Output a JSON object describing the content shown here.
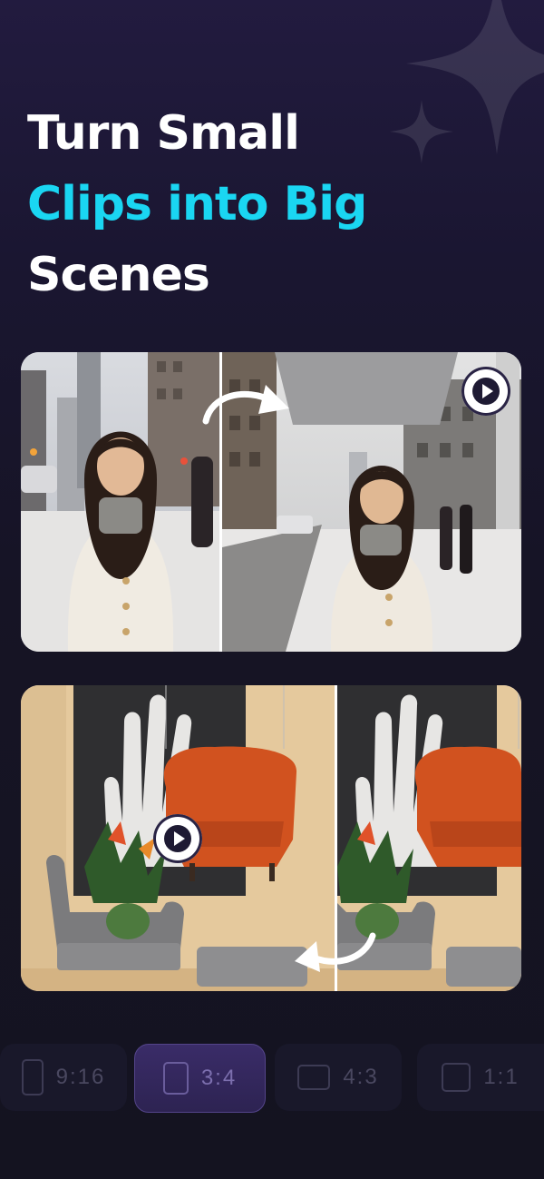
{
  "headline": {
    "line1": "Turn Small",
    "line2": "Clips into Big",
    "line3": "Scenes"
  },
  "colors": {
    "accent": "#1ad6f2",
    "background": "#161425",
    "selected_ratio": "#2d2352"
  },
  "cards": [
    {
      "name": "street-portrait-comparison",
      "before": "original-clip",
      "after": "expanded-clip",
      "play_icon": "play-icon",
      "arrow_icon": "curved-arrow-right-icon"
    },
    {
      "name": "interior-chairs-comparison",
      "before": "expanded-clip",
      "after": "original-clip",
      "play_icon": "play-icon",
      "arrow_icon": "curved-arrow-left-icon"
    }
  ],
  "ratios": [
    {
      "label": "9:16",
      "selected": false
    },
    {
      "label": "3:4",
      "selected": true
    },
    {
      "label": "4:3",
      "selected": false
    },
    {
      "label": "1:1",
      "selected": false
    }
  ]
}
